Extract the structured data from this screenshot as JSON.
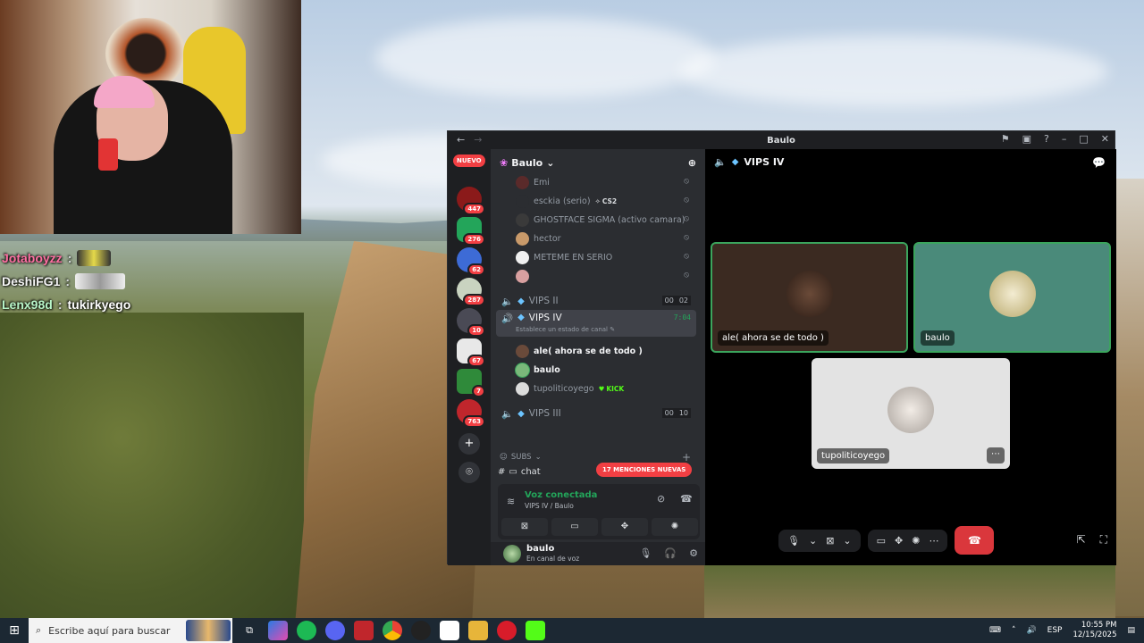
{
  "chat_overlay": {
    "lines": [
      {
        "name": "Jotaboyzz",
        "msg": ""
      },
      {
        "name": "DeshiFG1",
        "msg": ""
      },
      {
        "name": "Lenx98d",
        "msg": "tukirkyego"
      }
    ]
  },
  "discord": {
    "title": "Baulo",
    "guilds": {
      "nuevo": "NUEVO",
      "badges": [
        "447",
        "276",
        "62",
        "287",
        "10",
        "67",
        "7",
        "763"
      ]
    },
    "server": {
      "name": "Baulo"
    },
    "members_top": [
      {
        "name": "Emi"
      },
      {
        "name": "esckia (serio)",
        "tag": "CS2"
      },
      {
        "name": "GHOSTFACE SIGMA (activo camara)"
      },
      {
        "name": "hector"
      },
      {
        "name": "METEME EN SERIO"
      },
      {
        "name": ""
      }
    ],
    "voice_channels": [
      {
        "name": "VIPS II",
        "counts": [
          "00",
          "02"
        ]
      },
      {
        "name": "VIPS IV",
        "time": "7:04",
        "status": "Establece un estado de canal"
      },
      {
        "name": "VIPS III",
        "counts": [
          "00",
          "10"
        ]
      }
    ],
    "vips_iv_members": [
      {
        "name": "ale( ahora se de todo )"
      },
      {
        "name": "baulo"
      },
      {
        "name": "tupoliticoyego",
        "tag": "KICK"
      }
    ],
    "category": "SUBS",
    "chat_channel": "chat",
    "mentions_pill": "17 MENCIONES NUEVAS",
    "voice_panel": {
      "title": "Voz conectada",
      "subtitle": "VIPS IV / Baulo"
    },
    "user_panel": {
      "name": "baulo",
      "status": "En canal de voz"
    },
    "stage": {
      "channel": "VIPS IV",
      "tiles": [
        {
          "label": "ale( ahora se de todo )"
        },
        {
          "label": "baulo"
        },
        {
          "label": "tupoliticoyego"
        }
      ]
    },
    "colors": {
      "connected": "#23a55a",
      "speaking": "#3ba55d",
      "hangup": "#da373c"
    }
  },
  "taskbar": {
    "search_placeholder": "Escribe aquí para buscar",
    "lang": "ESP",
    "time": "10:55 PM",
    "date": "12/15/2025"
  }
}
